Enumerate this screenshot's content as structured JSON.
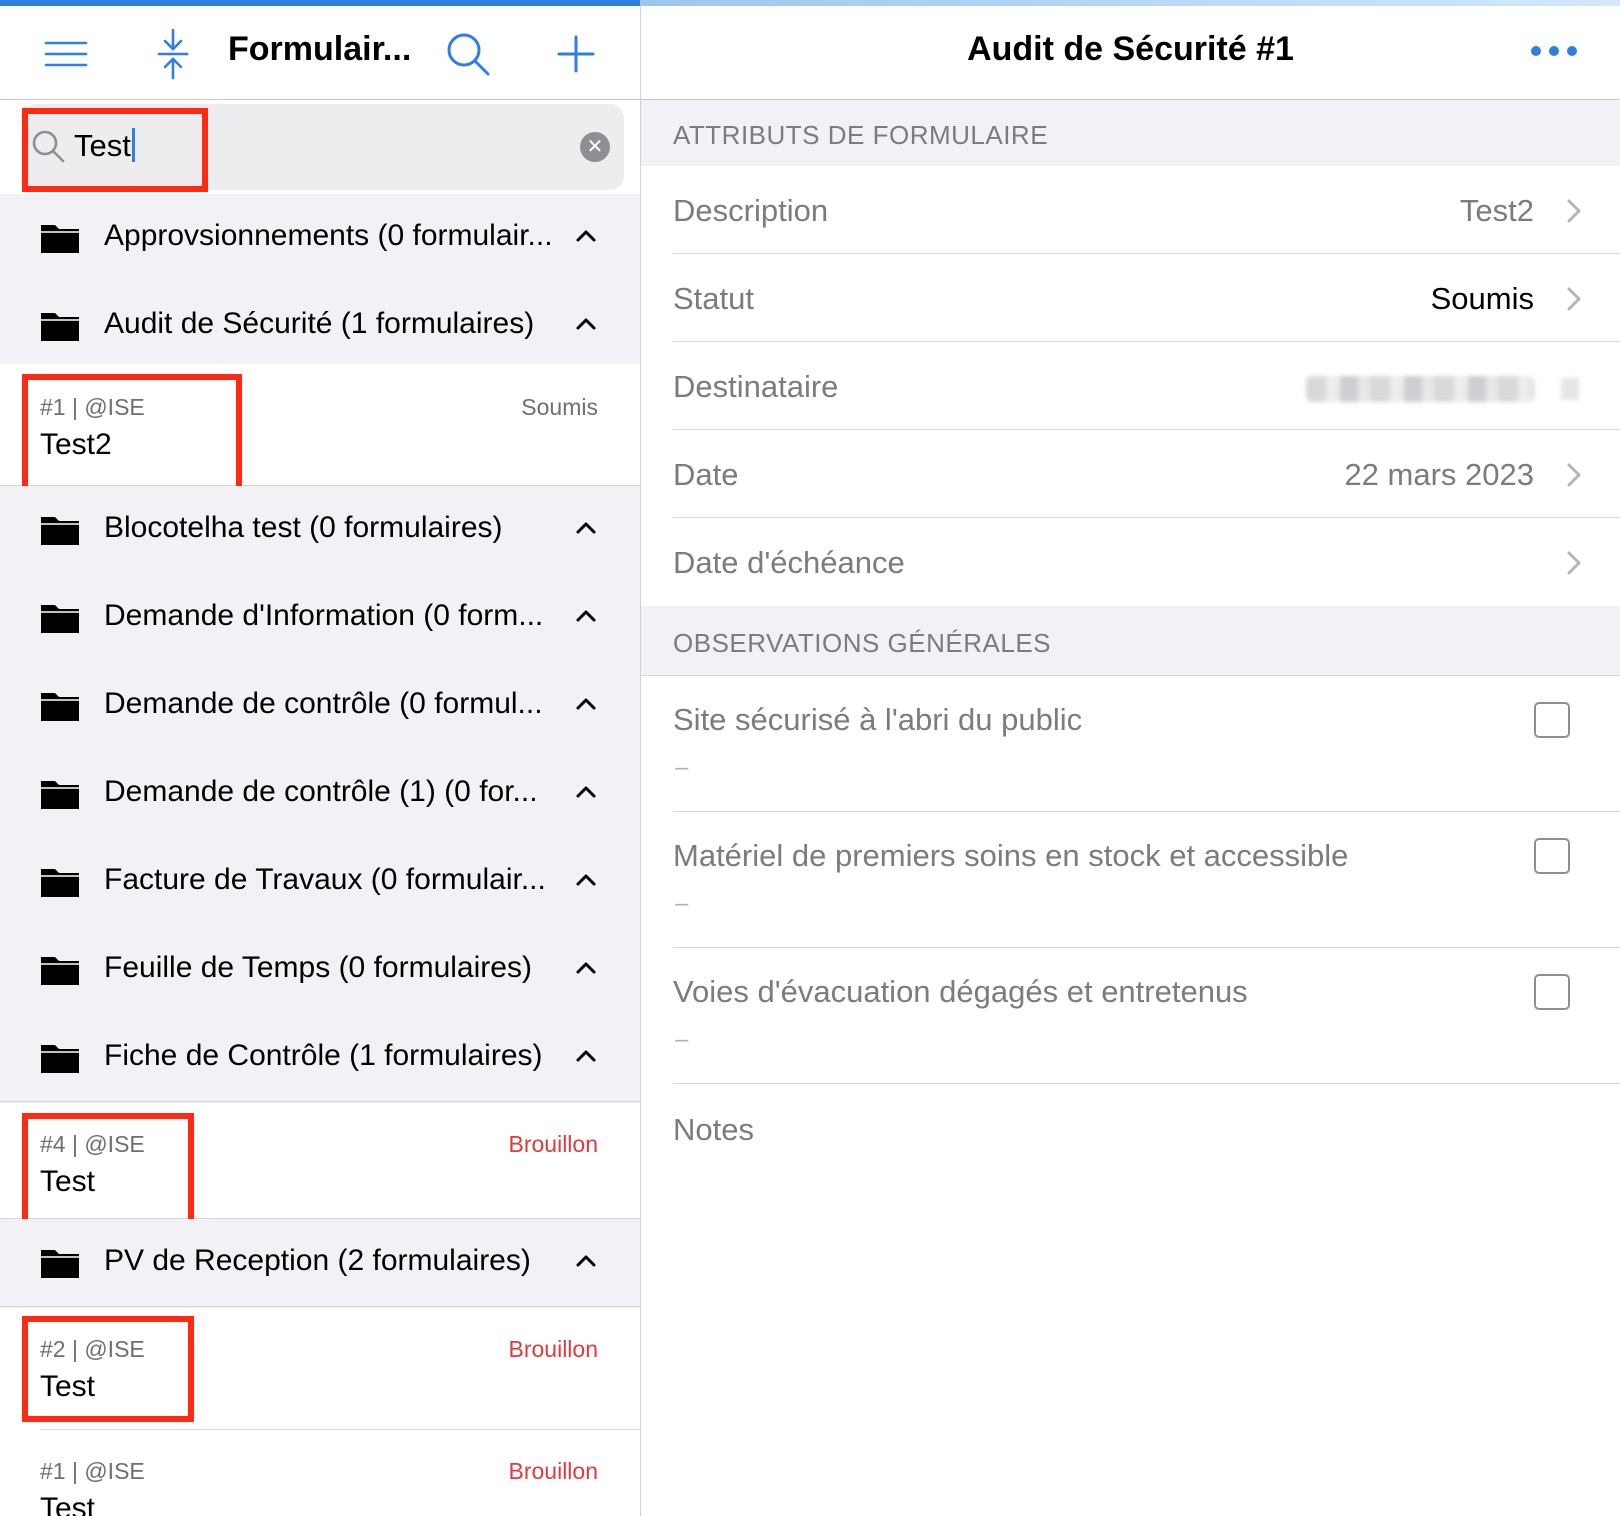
{
  "left_nav": {
    "title": "Formulair..."
  },
  "search": {
    "value": "Test"
  },
  "folders": [
    {
      "label": "Approvsionnements (0 formulair..."
    },
    {
      "label": "Audit de Sécurité (1 formulaires)"
    },
    {
      "label": "Blocotelha test (0 formulaires)"
    },
    {
      "label": "Demande d'Information (0 form..."
    },
    {
      "label": "Demande de contrôle (0 formul..."
    },
    {
      "label": "Demande de contrôle (1) (0 for..."
    },
    {
      "label": "Facture de Travaux (0 formulair..."
    },
    {
      "label": "Feuille de Temps (0 formulaires)"
    },
    {
      "label": "Fiche de Contrôle (1 formulaires)"
    },
    {
      "label": "PV de Reception (2 formulaires)"
    }
  ],
  "forms": [
    {
      "meta": "#1 | @ISE",
      "title": "Test2",
      "status": "Soumis",
      "status_color": "#6e6e73"
    },
    {
      "meta": "#4 | @ISE",
      "title": "Test",
      "status": "Brouillon",
      "status_color": "#e0393e"
    },
    {
      "meta": "#2 | @ISE",
      "title": "Test",
      "status": "Brouillon",
      "status_color": "#e0393e"
    },
    {
      "meta": "#1 | @ISE",
      "title": "Test",
      "status": "Brouillon",
      "status_color": "#e0393e"
    }
  ],
  "detail": {
    "title": "Audit de Sécurité #1",
    "section_attributes": "ATTRIBUTS DE FORMULAIRE",
    "attributes": [
      {
        "label": "Description",
        "value": "Test2"
      },
      {
        "label": "Statut",
        "value": "Soumis"
      },
      {
        "label": "Destinataire",
        "value": ""
      },
      {
        "label": "Date",
        "value": "22 mars 2023"
      },
      {
        "label": "Date d'échéance",
        "value": ""
      }
    ],
    "section_observations": "OBSERVATIONS GÉNÉRALES",
    "observations": [
      {
        "label": "Site sécurisé à l'abri du public",
        "value": "–"
      },
      {
        "label": "Matériel de premiers soins en stock et accessible",
        "value": "–"
      },
      {
        "label": "Voies d'évacuation dégagés et entretenus",
        "value": "–"
      }
    ],
    "notes_label": "Notes"
  },
  "colors": {
    "accent": "#2f7fe0",
    "highlight": "#ff2a14",
    "draft": "#e0393e"
  }
}
